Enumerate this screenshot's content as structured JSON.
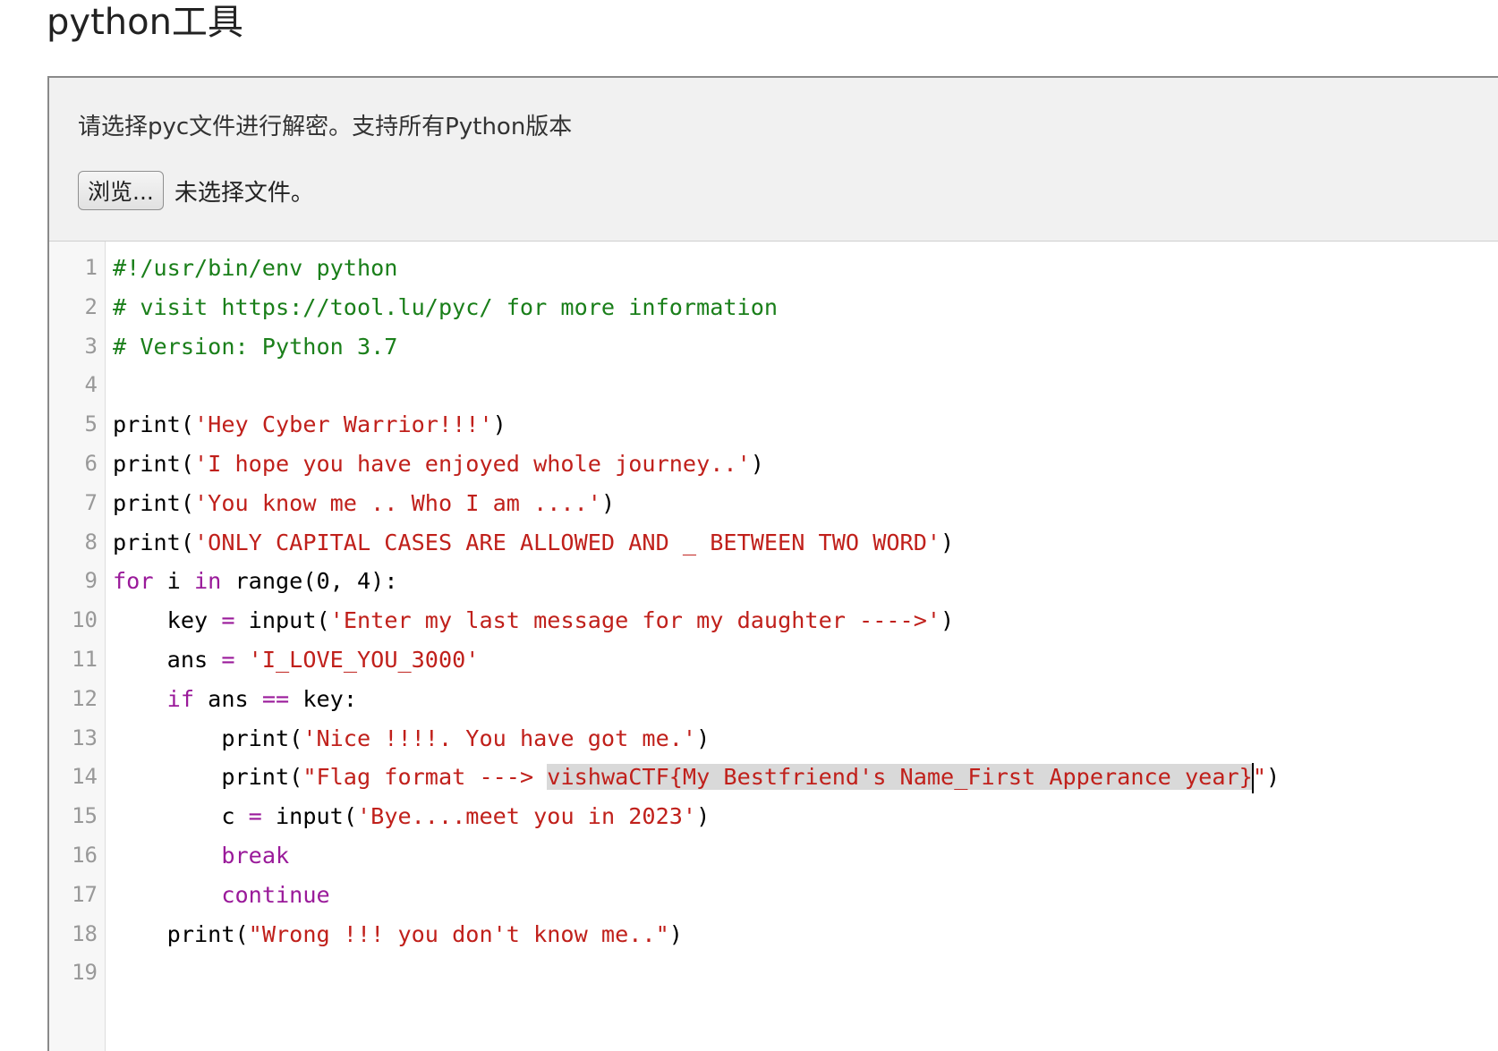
{
  "page": {
    "title": "python工具"
  },
  "upload": {
    "description": "请选择pyc文件进行解密。支持所有Python版本",
    "browse_label": "浏览...",
    "file_status": "未选择文件。"
  },
  "editor": {
    "line_numbers": [
      "1",
      "2",
      "3",
      "4",
      "5",
      "6",
      "7",
      "8",
      "9",
      "10",
      "11",
      "12",
      "13",
      "14",
      "15",
      "16",
      "17",
      "18",
      "19"
    ],
    "lines": [
      [
        {
          "t": "#!/usr/bin/env python",
          "c": "cm"
        }
      ],
      [
        {
          "t": "# visit https://tool.lu/pyc/ for more information",
          "c": "cm"
        }
      ],
      [
        {
          "t": "# Version: Python 3.7",
          "c": "cm"
        }
      ],
      [],
      [
        {
          "t": "print("
        },
        {
          "t": "'Hey Cyber Warrior!!!'",
          "c": "st"
        },
        {
          "t": ")"
        }
      ],
      [
        {
          "t": "print("
        },
        {
          "t": "'I hope you have enjoyed whole journey..'",
          "c": "st"
        },
        {
          "t": ")"
        }
      ],
      [
        {
          "t": "print("
        },
        {
          "t": "'You know me .. Who I am ....'",
          "c": "st"
        },
        {
          "t": ")"
        }
      ],
      [
        {
          "t": "print("
        },
        {
          "t": "'ONLY CAPITAL CASES ARE ALLOWED AND _ BETWEEN TWO WORD'",
          "c": "st"
        },
        {
          "t": ")"
        }
      ],
      [
        {
          "t": "for",
          "c": "kw"
        },
        {
          "t": " i "
        },
        {
          "t": "in",
          "c": "kw"
        },
        {
          "t": " range(0, 4):"
        }
      ],
      [
        {
          "t": "    key "
        },
        {
          "t": "=",
          "c": "op"
        },
        {
          "t": " input("
        },
        {
          "t": "'Enter my last message for my daughter ---->'",
          "c": "st"
        },
        {
          "t": ")"
        }
      ],
      [
        {
          "t": "    ans "
        },
        {
          "t": "=",
          "c": "op"
        },
        {
          "t": " "
        },
        {
          "t": "'I_LOVE_YOU_3000'",
          "c": "st"
        }
      ],
      [
        {
          "t": "    "
        },
        {
          "t": "if",
          "c": "kw"
        },
        {
          "t": " ans "
        },
        {
          "t": "==",
          "c": "op"
        },
        {
          "t": " key:"
        }
      ],
      [
        {
          "t": "        print("
        },
        {
          "t": "'Nice !!!!. You have got me.'",
          "c": "st"
        },
        {
          "t": ")"
        }
      ],
      [
        {
          "t": "        print("
        },
        {
          "t": "\"Flag format ---> ",
          "c": "st"
        },
        {
          "t": "vishwaCTF{My Bestfriend's Name_First Apperance year}",
          "c": "st sel"
        },
        {
          "t": "",
          "c": "cursor"
        },
        {
          "t": "\"",
          "c": "st"
        },
        {
          "t": ")"
        }
      ],
      [
        {
          "t": "        c "
        },
        {
          "t": "=",
          "c": "op"
        },
        {
          "t": " input("
        },
        {
          "t": "'Bye....meet you in 2023'",
          "c": "st"
        },
        {
          "t": ")"
        }
      ],
      [
        {
          "t": "        "
        },
        {
          "t": "break",
          "c": "kw"
        }
      ],
      [
        {
          "t": "        "
        },
        {
          "t": "continue",
          "c": "kw"
        }
      ],
      [
        {
          "t": "    print("
        },
        {
          "t": "\"Wrong !!! you don't know me..\"",
          "c": "st"
        },
        {
          "t": ")"
        }
      ],
      []
    ]
  }
}
